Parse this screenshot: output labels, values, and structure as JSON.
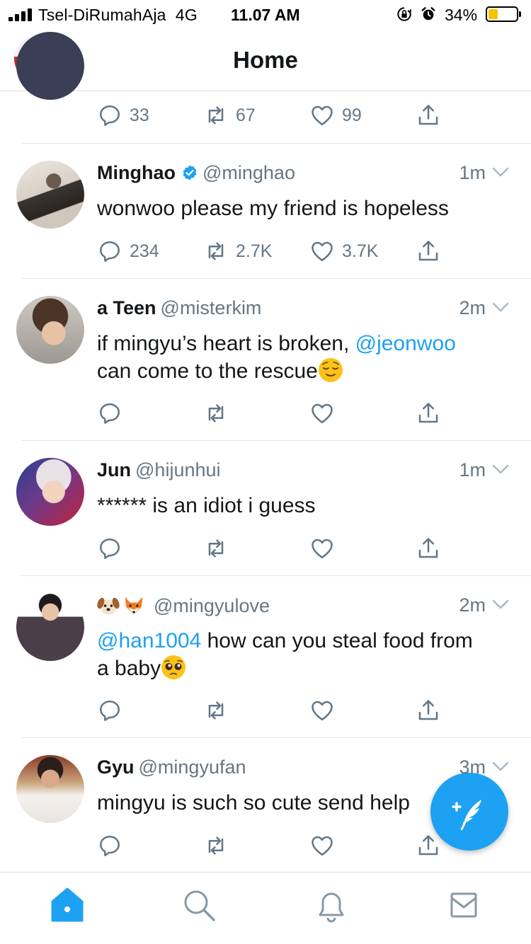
{
  "status_bar": {
    "carrier": "Tsel-DiRumahAja",
    "network": "4G",
    "time": "11.07 AM",
    "battery": "34%",
    "battery_level": 0.34
  },
  "header": {
    "title": "Home"
  },
  "colors": {
    "accent": "#1da1f2",
    "muted": "#657786",
    "text": "#14171a"
  },
  "timeline": {
    "partial": {
      "replies": "33",
      "retweets": "67",
      "likes": "99"
    },
    "tweets": [
      {
        "name": "Minghao",
        "verified": true,
        "handle": "@minghao",
        "time": "1m",
        "text": "wonwoo please my friend is hopeless",
        "replies": "234",
        "retweets": "2.7K",
        "likes": "3.7K"
      },
      {
        "name": "a Teen",
        "handle": "@misterkim",
        "time": "2m",
        "text_part1": "if mingyu’s heart is broken, ",
        "mention": "@jeonwoo",
        "text_part2": "can come to the rescue",
        "emoji": "relieved-face"
      },
      {
        "name": "Jun",
        "handle": "@hijunhui",
        "time": "1m",
        "text": "****** is an idiot i guess"
      },
      {
        "name_emoji": [
          "dog-face",
          "fox-face"
        ],
        "handle": "@mingyulove",
        "time": "2m",
        "mention": "@han1004",
        "text_part1": " how can you steal food from",
        "text_part2": "a baby",
        "emoji": "pleading-face"
      },
      {
        "name": "Gyu",
        "handle": "@mingyufan",
        "time": "3m",
        "text": "mingyu is such so cute send help"
      }
    ]
  },
  "tabbar": {
    "items": [
      "home-icon",
      "search-icon",
      "bell-icon",
      "envelope-icon"
    ],
    "active": "home-icon"
  }
}
